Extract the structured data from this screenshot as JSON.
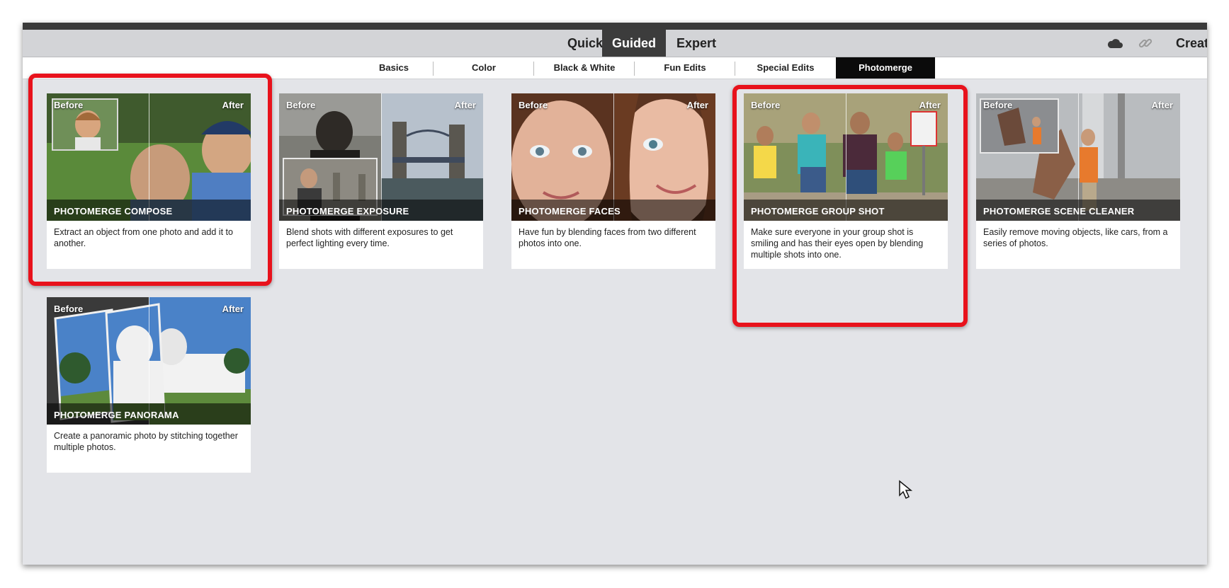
{
  "modes": {
    "quick": "Quick",
    "guided": "Guided",
    "expert": "Expert",
    "create": "Creat"
  },
  "icons": {
    "cloud": "cloud-icon",
    "link": "link-icon"
  },
  "categories": [
    "Basics",
    "Color",
    "Black & White",
    "Fun Edits",
    "Special Edits",
    "Photomerge"
  ],
  "active_category": "Photomerge",
  "labels": {
    "before": "Before",
    "after": "After"
  },
  "cards": [
    {
      "title": "PHOTOMERGE COMPOSE",
      "description": "Extract an object from one photo and add it to another.",
      "highlighted": true
    },
    {
      "title": "PHOTOMERGE EXPOSURE",
      "description": "Blend shots with different exposures to get perfect lighting every time.",
      "highlighted": false
    },
    {
      "title": "PHOTOMERGE FACES",
      "description": "Have fun by blending faces from two different photos into one.",
      "highlighted": false
    },
    {
      "title": "PHOTOMERGE GROUP SHOT",
      "description": "Make sure everyone in your group shot is smiling and has their eyes open by blending multiple shots into one.",
      "highlighted": true
    },
    {
      "title": "PHOTOMERGE SCENE CLEANER",
      "description": "Easily remove moving objects, like cars, from a series of photos.",
      "highlighted": false
    },
    {
      "title": "PHOTOMERGE PANORAMA",
      "description": "Create a panoramic photo by stitching together multiple photos.",
      "highlighted": false
    }
  ],
  "colors": {
    "highlight": "#e8121c",
    "active_tab": "#3c3c3c",
    "active_category": "#0b0b0b",
    "workspace": "#e3e4e8"
  }
}
